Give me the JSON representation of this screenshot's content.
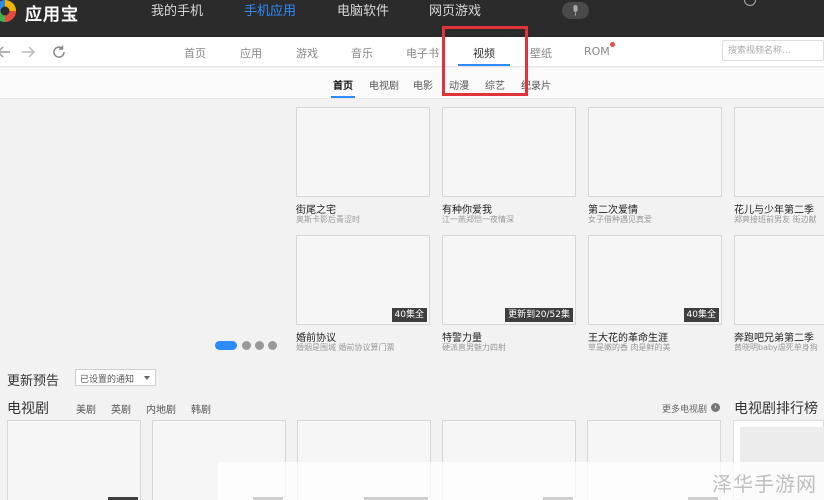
{
  "app": {
    "title": "应用宝"
  },
  "topnav": [
    {
      "label": "我的手机",
      "active": false
    },
    {
      "label": "手机应用",
      "active": true
    },
    {
      "label": "电脑软件",
      "active": false
    },
    {
      "label": "网页游戏",
      "active": false
    }
  ],
  "colors": {
    "accent": "#2e8bff",
    "topbar": "#2b2b2b",
    "highlight": "#e0333a"
  },
  "icons": [
    "back-arrow-icon",
    "forward-arrow-icon",
    "refresh-icon",
    "microphone-icon"
  ],
  "navbar": {
    "tabs": [
      {
        "label": "首页"
      },
      {
        "label": "应用"
      },
      {
        "label": "游戏"
      },
      {
        "label": "音乐"
      },
      {
        "label": "电子书"
      },
      {
        "label": "视频",
        "active": true
      },
      {
        "label": "壁纸"
      },
      {
        "label": "ROM"
      }
    ],
    "search_placeholder": "搜索视频名称..."
  },
  "subnav": {
    "tabs": [
      {
        "label": "首页",
        "active": true
      },
      {
        "label": "电视剧"
      },
      {
        "label": "电影"
      },
      {
        "label": "动漫"
      },
      {
        "label": "综艺"
      },
      {
        "label": "纪录片"
      }
    ]
  },
  "featured": {
    "row1": [
      {
        "title": "街尾之宅",
        "subtitle": "奥斯卡影后青涩时",
        "badge": ""
      },
      {
        "title": "有种你爱我",
        "subtitle": "江一燕郑恺一夜情深",
        "badge": ""
      },
      {
        "title": "第二次爱情",
        "subtitle": "女子借种遇见真爱",
        "badge": ""
      },
      {
        "title": "花儿与少年第二季",
        "subtitle": "郑爽接班前男友 街边献",
        "badge": ""
      }
    ],
    "row2": [
      {
        "title": "婚前协议",
        "subtitle": "婚姻是围城 婚前协议算门票",
        "badge": "40集全"
      },
      {
        "title": "特警力量",
        "subtitle": "硬派直男魅力四射",
        "badge": "更新到20/52集"
      },
      {
        "title": "王大花的革命生涯",
        "subtitle": "草是嫩的香 肉是鲜的美",
        "badge": "40集全"
      },
      {
        "title": "奔跑吧兄弟第二季",
        "subtitle": "黄晓明baby虐死单身狗",
        "badge": ""
      }
    ],
    "carousel": {
      "count": 4,
      "active_index": 0
    }
  },
  "preview": {
    "title": "更新预告",
    "notice_select": "已设置的通知"
  },
  "tv": {
    "title": "电视剧",
    "genres": [
      "美剧",
      "英剧",
      "内地剧",
      "韩剧"
    ],
    "more": "更多电视剧",
    "ranking_title": "电视剧排行榜"
  },
  "watermark": "泽华手游网"
}
